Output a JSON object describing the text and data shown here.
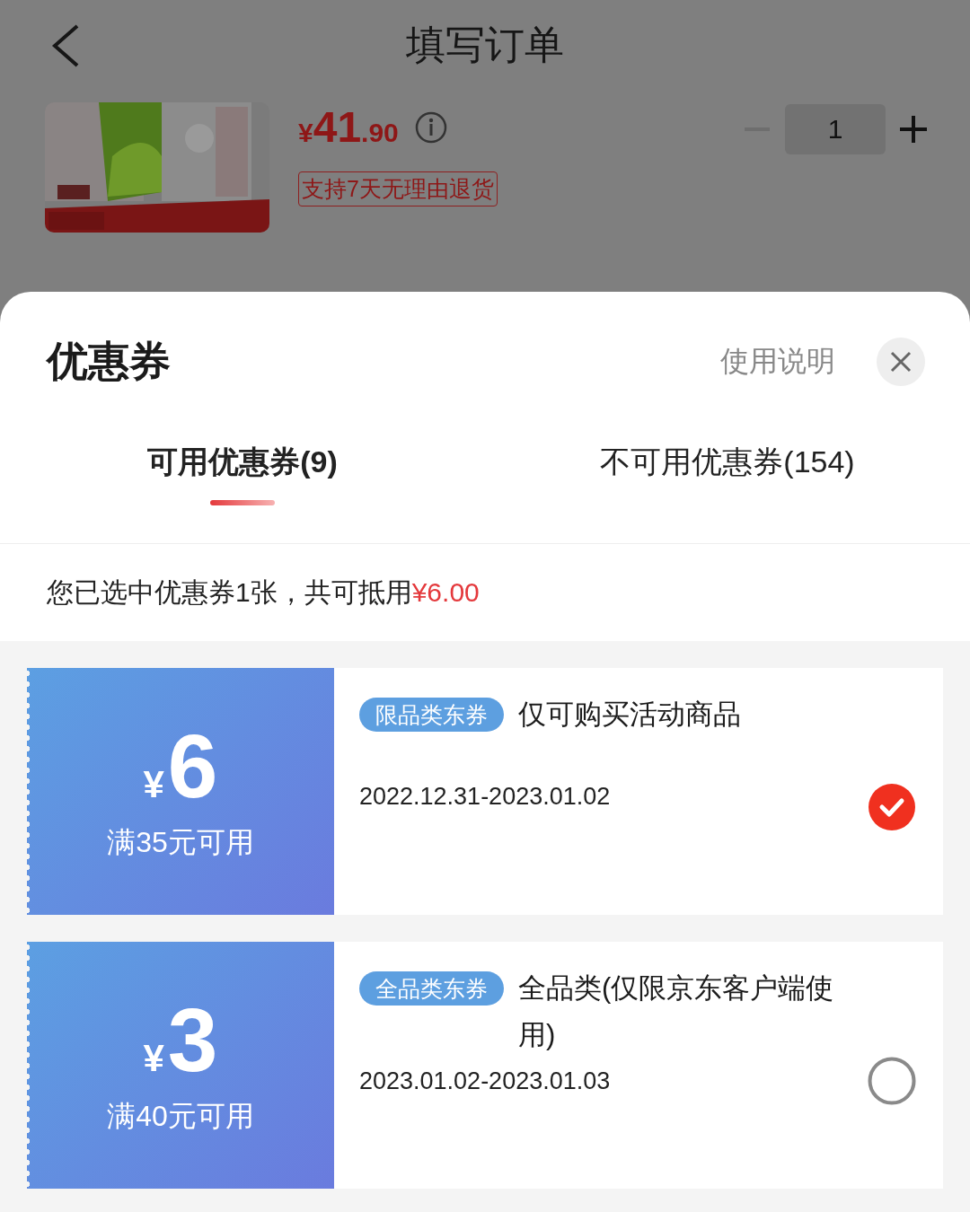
{
  "header": {
    "title": "填写订单"
  },
  "product": {
    "kind": "picture",
    "price": {
      "currency": "¥",
      "integer": "41",
      "decimal": ".90"
    },
    "tag": "支持7天无理由退货",
    "quantity": "1"
  },
  "sheet": {
    "title": "优惠券",
    "help_link": "使用说明",
    "tabs": [
      {
        "label": "可用优惠券(9)",
        "selected": true
      },
      {
        "label": "不可用优惠券(154)",
        "selected": false
      }
    ],
    "summary": {
      "text": "您已选中优惠券1张，共可抵用",
      "amount": "¥6.00"
    },
    "coupons": [
      {
        "currency": "¥",
        "amount": "6",
        "condition": "满35元可用",
        "tag": "限品类东券",
        "title": "仅可购买活动商品",
        "dates": "2022.12.31-2023.01.02",
        "selected": true
      },
      {
        "currency": "¥",
        "amount": "3",
        "condition": "满40元可用",
        "tag": "全品类东券",
        "title": "全品类(仅限京东客户端使用)",
        "dates": "2023.01.02-2023.01.03",
        "selected": false
      }
    ]
  }
}
